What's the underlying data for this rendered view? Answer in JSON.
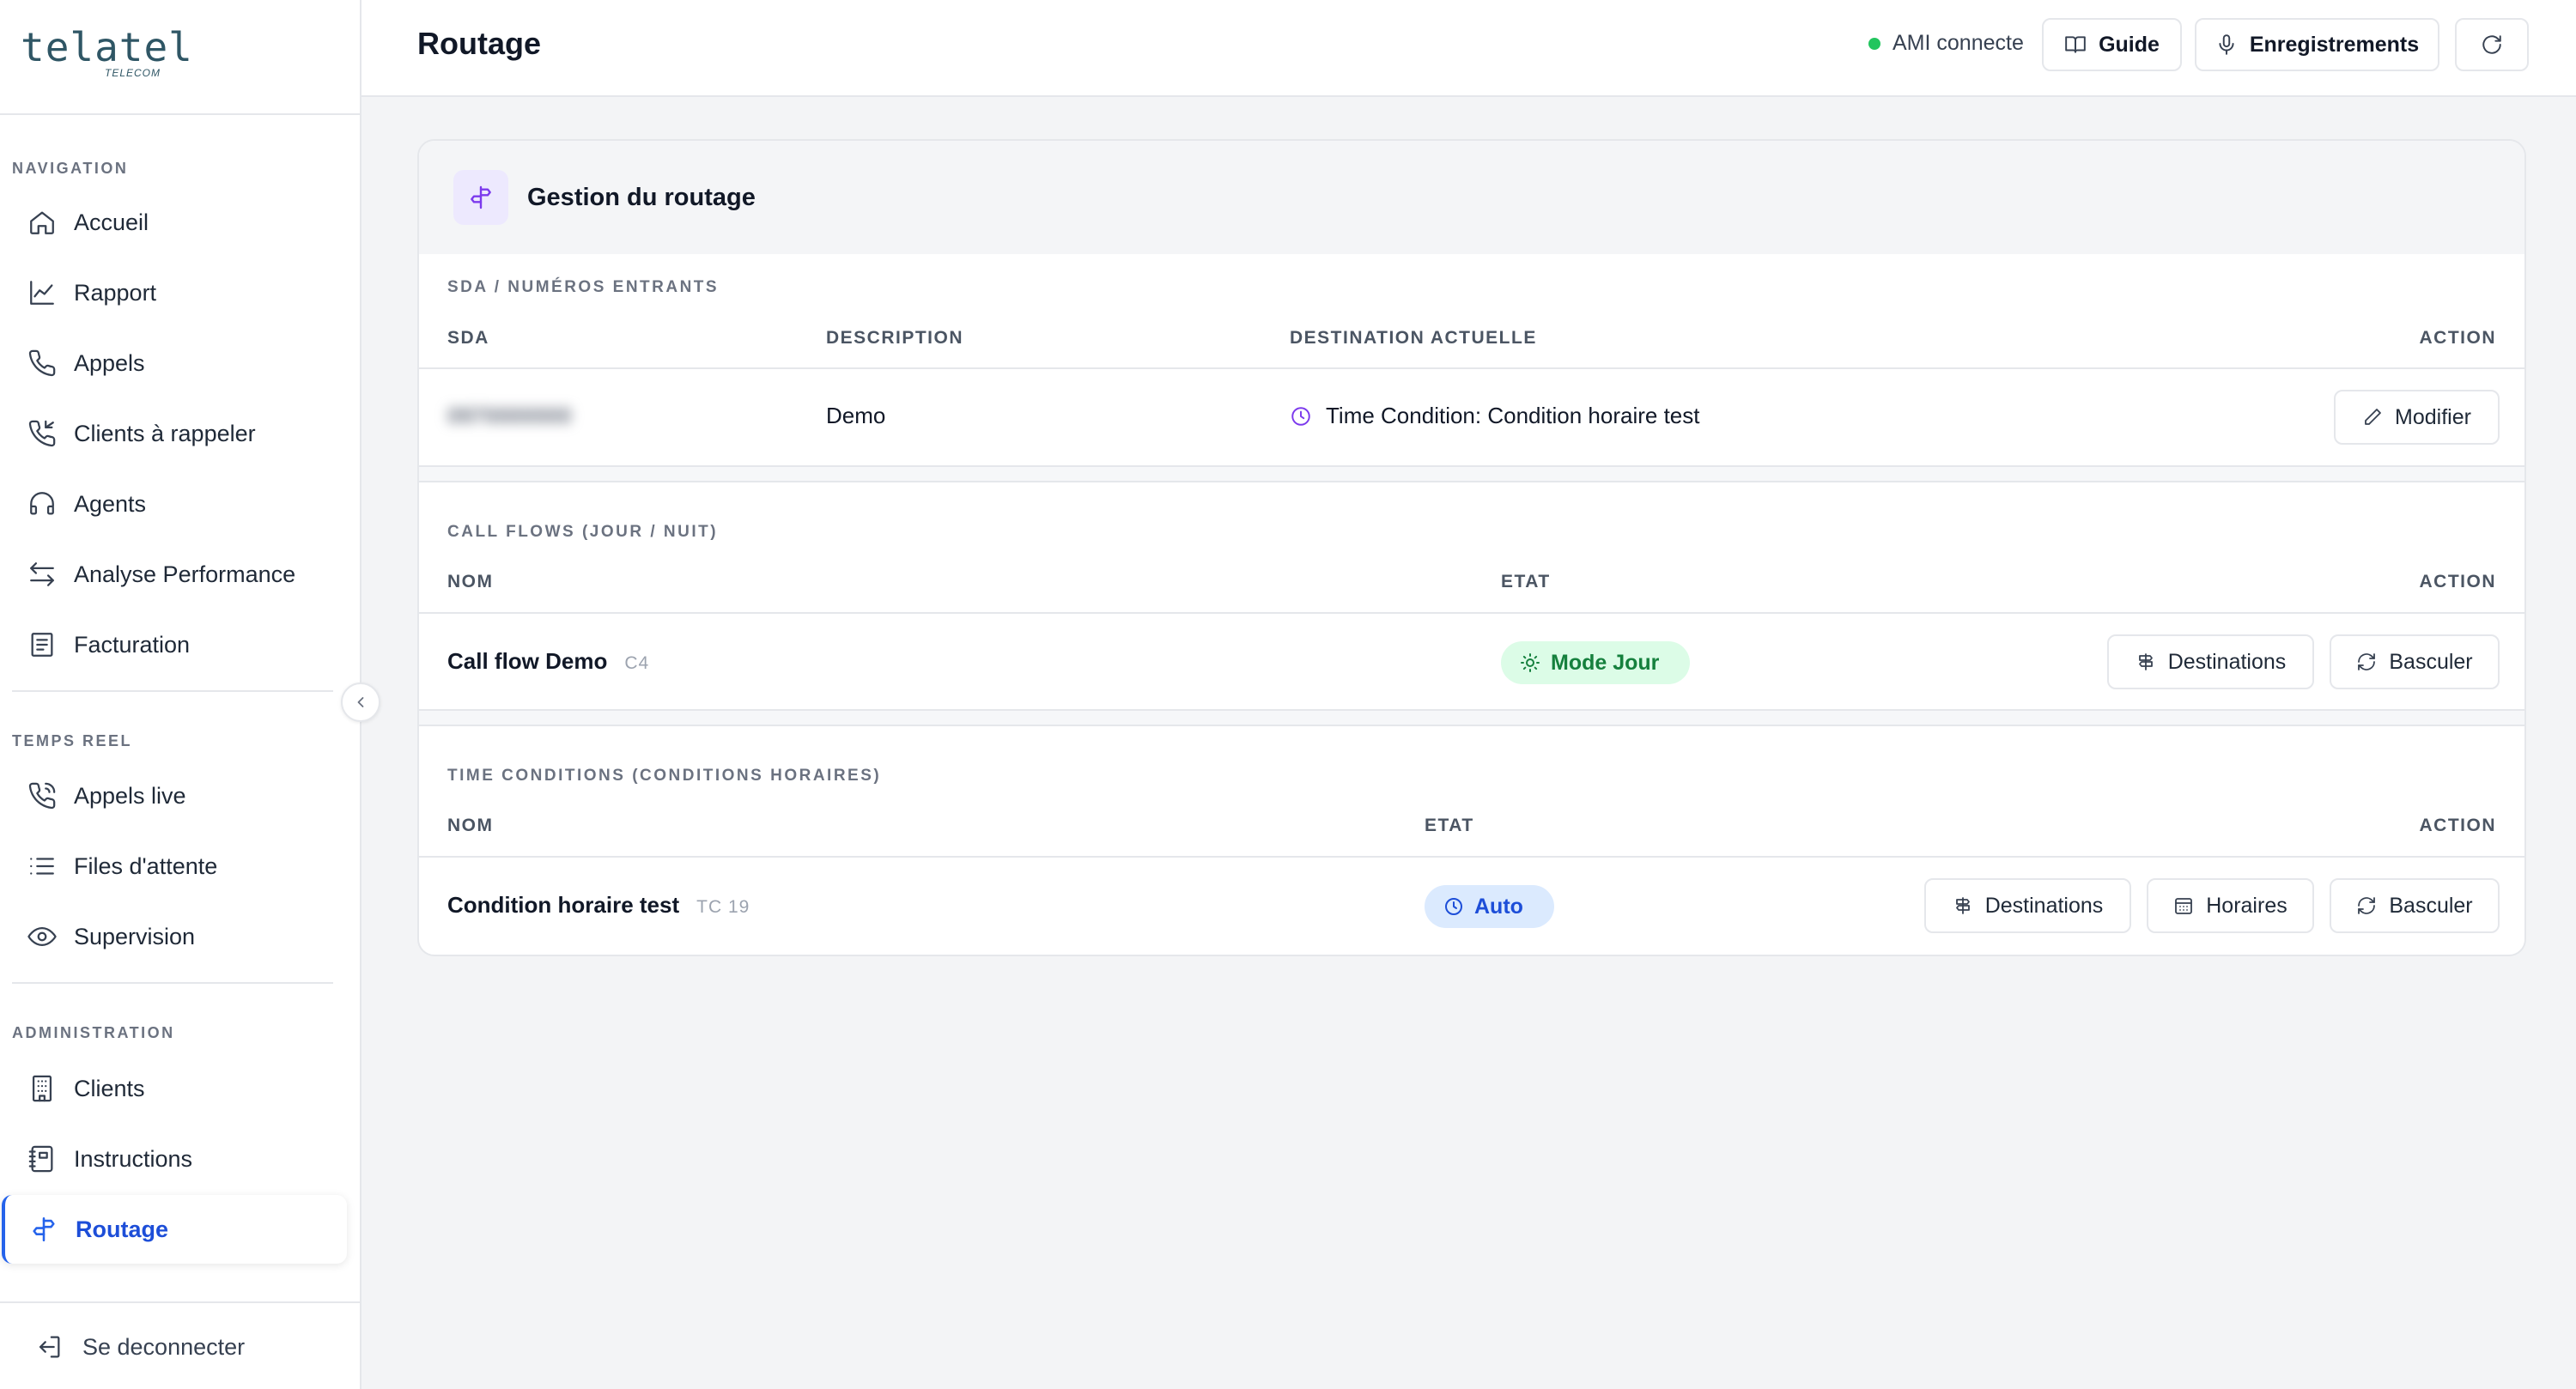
{
  "brand": {
    "name": "telatel",
    "sub": "TELECOM"
  },
  "sidebar": {
    "sections": {
      "navigation": "NAVIGATION",
      "realtime": "TEMPS REEL",
      "admin": "ADMINISTRATION"
    },
    "items": {
      "accueil": "Accueil",
      "rapport": "Rapport",
      "appels": "Appels",
      "clients_rappeler": "Clients à rappeler",
      "agents": "Agents",
      "analyse": "Analyse Performance",
      "facturation": "Facturation",
      "appels_live": "Appels live",
      "files": "Files d'attente",
      "supervision": "Supervision",
      "clients": "Clients",
      "instructions": "Instructions",
      "routage": "Routage"
    },
    "logout": "Se deconnecter",
    "accent_color": "#2563eb"
  },
  "header": {
    "title": "Routage",
    "ami_status": "AMI connecte",
    "guide_label": "Guide",
    "recordings_label": "Enregistrements"
  },
  "card": {
    "title": "Gestion du routage",
    "sda": {
      "section_label": "SDA / NUMÉROS ENTRANTS",
      "columns": {
        "sda": "SDA",
        "description": "DESCRIPTION",
        "destination": "DESTINATION ACTUELLE",
        "action": "ACTION"
      },
      "rows": [
        {
          "sda": "0970000000",
          "description": "Demo",
          "destination": "Time Condition: Condition horaire test",
          "action": "Modifier"
        }
      ]
    },
    "call_flows": {
      "section_label": "CALL FLOWS (JOUR / NUIT)",
      "columns": {
        "name": "NOM",
        "state": "ETAT",
        "action": "ACTION"
      },
      "rows": [
        {
          "name": "Call flow Demo",
          "code": "C4",
          "state": "Mode Jour",
          "destinations": "Destinations",
          "toggle": "Basculer"
        }
      ]
    },
    "time_conditions": {
      "section_label": "TIME CONDITIONS (CONDITIONS HORAIRES)",
      "columns": {
        "name": "NOM",
        "state": "ETAT",
        "action": "ACTION"
      },
      "rows": [
        {
          "name": "Condition horaire test",
          "code": "TC 19",
          "state": "Auto",
          "destinations": "Destinations",
          "schedules": "Horaires",
          "toggle": "Basculer"
        }
      ]
    }
  }
}
